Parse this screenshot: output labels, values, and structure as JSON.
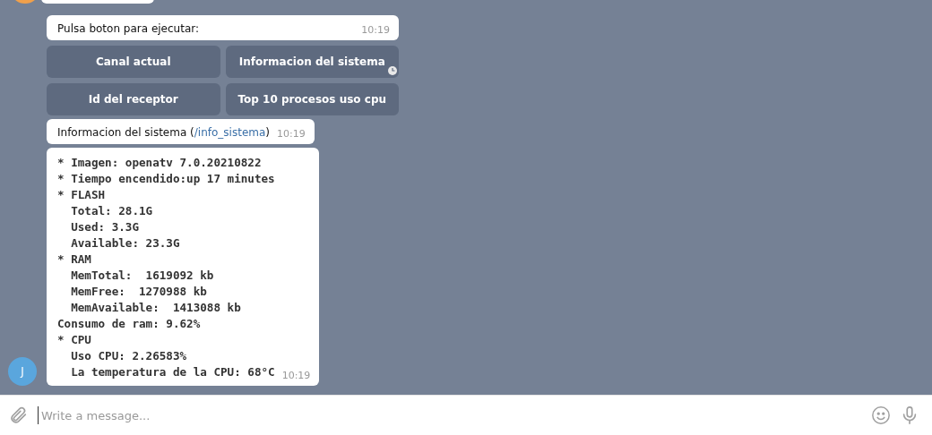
{
  "messages": [
    {
      "kind": "text",
      "text": "Pulsa boton para ejecutar:",
      "time": "10:19"
    },
    {
      "kind": "keyboard",
      "buttons": [
        {
          "label": "Canal actual",
          "pending": false
        },
        {
          "label": "Informacion del sistema",
          "pending": true
        },
        {
          "label": "Id del receptor",
          "pending": false
        },
        {
          "label": "Top 10 procesos uso cpu",
          "pending": false
        }
      ]
    },
    {
      "kind": "command",
      "text": "Informacion del sistema (",
      "link": "/info_sistema",
      "after": ")",
      "time": "10:19"
    },
    {
      "kind": "code",
      "lines": [
        "* Imagen: openatv 7.0.20210822",
        "* Tiempo encendido:up 17 minutes",
        "* FLASH",
        "  Total: 28.1G",
        "  Used: 3.3G",
        "  Available: 23.3G",
        "* RAM",
        "  MemTotal:  1619092 kb",
        "  MemFree:  1270988 kb",
        "  MemAvailable:  1413088 kb",
        "Consumo de ram: 9.62%",
        "* CPU",
        "  Uso CPU: 2.26583%",
        "  La temperatura de la CPU: 68°C"
      ],
      "time": "10:19",
      "avatar": "J"
    }
  ],
  "composer": {
    "placeholder": "Write a message..."
  }
}
